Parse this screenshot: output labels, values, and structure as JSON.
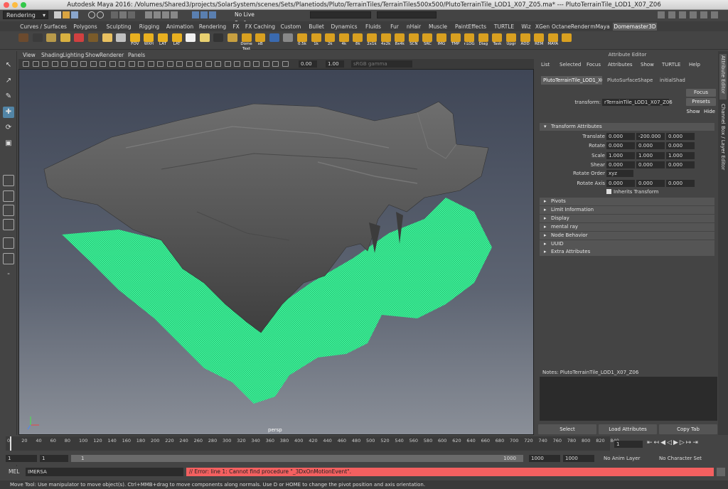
{
  "window": {
    "title": "Autodesk Maya 2016: /Volumes/Shared3/projects/SolarSystem/scenes/Sets/Planetiods/Pluto/TerrainTiles/TerrainTiles500x500/PlutoTerrainTile_LOD1_X07_Z05.ma*   ---   PlutoTerrainTile_LOD1_X07_Z06"
  },
  "statusline": {
    "menu_set": "Rendering",
    "live_surface": "No Live Surface"
  },
  "shelf_tabs": [
    {
      "label": "Curves / Surfaces"
    },
    {
      "label": "Polygons"
    },
    {
      "label": "Sculpting"
    },
    {
      "label": "Rigging"
    },
    {
      "label": "Animation"
    },
    {
      "label": "Rendering"
    },
    {
      "label": "FX"
    },
    {
      "label": "FX Caching"
    },
    {
      "label": "Custom"
    },
    {
      "label": "Bullet"
    },
    {
      "label": "Dynamics"
    },
    {
      "label": "Fluids"
    },
    {
      "label": "Fur"
    },
    {
      "label": "nHair"
    },
    {
      "label": "Muscle"
    },
    {
      "label": "PaintEffects"
    },
    {
      "label": "TURTLE"
    },
    {
      "label": "Wiz"
    },
    {
      "label": "XGen"
    },
    {
      "label": "OctaneRender"
    },
    {
      "label": "mMaya"
    },
    {
      "label": "Domemaster3D"
    }
  ],
  "shelf_buttons": [
    {
      "label": ""
    },
    {
      "label": ""
    },
    {
      "label": ""
    },
    {
      "label": ""
    },
    {
      "label": ""
    },
    {
      "label": ""
    },
    {
      "label": ""
    },
    {
      "label": ""
    },
    {
      "label": "FOV"
    },
    {
      "label": "WXH"
    },
    {
      "label": "LAT"
    },
    {
      "label": "LAT"
    },
    {
      "label": ""
    },
    {
      "label": ""
    },
    {
      "label": ""
    },
    {
      "label": ""
    },
    {
      "label": "Dome Text"
    },
    {
      "label": "xB"
    },
    {
      "label": ""
    },
    {
      "label": ""
    },
    {
      "label": "0.5k"
    },
    {
      "label": "1k"
    },
    {
      "label": "2k"
    },
    {
      "label": "4k"
    },
    {
      "label": "8k"
    },
    {
      "label": "2x1k"
    },
    {
      "label": "4x2k"
    },
    {
      "label": "8x4k"
    },
    {
      "label": "SCN"
    },
    {
      "label": "SRC"
    },
    {
      "label": "IMG"
    },
    {
      "label": "TMP"
    },
    {
      "label": "r.LOG"
    },
    {
      "label": "Diag"
    },
    {
      "label": "Task"
    },
    {
      "label": "Upgr"
    },
    {
      "label": "ADD"
    },
    {
      "label": "REM"
    },
    {
      "label": "MAYA"
    },
    {
      "label": ""
    }
  ],
  "viewport": {
    "menus": [
      "View",
      "Shading",
      "Lighting",
      "Show",
      "Renderer",
      "Panels"
    ],
    "near_value": "0.00",
    "gamma_value": "1.00",
    "colorspace": "sRGB gamma",
    "camera_label": "persp"
  },
  "attribute_editor": {
    "header": "Attribute Editor",
    "menus": [
      "List",
      "Selected",
      "Focus",
      "Attributes",
      "Show",
      "TURTLE",
      "Help"
    ],
    "node_tabs": [
      "PlutoTerrainTile_LOD1_X07_Z06",
      "PlutoSurfaceShape",
      "initialShad"
    ],
    "transform_label": "transform:",
    "transform_name": "rTerrainTile_LOD1_X07_Z06",
    "focus_button": "Focus",
    "presets_button": "Presets",
    "show_button": "Show",
    "hide_button": "Hide",
    "transform_section": "Transform Attributes",
    "rows": [
      {
        "label": "Translate",
        "values": [
          "0.000",
          "-200.000",
          "0.000"
        ]
      },
      {
        "label": "Rotate",
        "values": [
          "0.000",
          "0.000",
          "0.000"
        ]
      },
      {
        "label": "Scale",
        "values": [
          "1.000",
          "1.000",
          "1.000"
        ]
      },
      {
        "label": "Shear",
        "values": [
          "0.000",
          "0.000",
          "0.000"
        ]
      }
    ],
    "rotate_order_label": "Rotate Order",
    "rotate_order_value": "xyz",
    "rotate_axis_label": "Rotate Axis",
    "rotate_axis_values": [
      "0.000",
      "0.000",
      "0.000"
    ],
    "inherits_transform": "Inherits Transform",
    "collapsed_sections": [
      "Pivots",
      "Limit Information",
      "Display",
      "mental ray",
      "Node Behavior",
      "UUID",
      "Extra Attributes"
    ],
    "notes_label": "Notes:  PlutoTerrainTile_LOD1_X07_Z06",
    "bottom_buttons": [
      "Select",
      "Load Attributes",
      "Copy Tab"
    ],
    "side_tabs": [
      "Attribute Editor",
      "Channel Box / Layer Editor"
    ]
  },
  "timeline": {
    "ticks": [
      "0",
      "20",
      "40",
      "60",
      "80",
      "100",
      "120",
      "140",
      "160",
      "180",
      "200",
      "220",
      "240",
      "260",
      "280",
      "300",
      "320",
      "340",
      "360",
      "380",
      "400",
      "420",
      "440",
      "460",
      "480",
      "500",
      "520",
      "540",
      "560",
      "580",
      "600",
      "620",
      "640",
      "660",
      "680",
      "700",
      "720",
      "740",
      "760",
      "780",
      "800",
      "820",
      "840"
    ],
    "current_frame": "1"
  },
  "range": {
    "start": "1",
    "inner_start": "1",
    "slider_start": "1",
    "slider_end": "1000",
    "inner_end": "1000",
    "end": "1000",
    "anim_layer": "No Anim Layer",
    "char_set": "No Character Set"
  },
  "command_line": {
    "lang": "MEL",
    "input": "IMERSA",
    "error": "// Error: line 1: Cannot find procedure \"_3DxOnMotionEvent\"."
  },
  "help_line": "Move Tool: Use manipulator to move object(s). Ctrl+MMB+drag to move components along normals. Use D or HOME to change the pivot position and axis orientation.",
  "colors": {
    "terrain_gray": "#5a5a5a",
    "wire_green": "#3ef29a",
    "error_red": "#f46060",
    "active_tab": "#5d5d5d"
  }
}
